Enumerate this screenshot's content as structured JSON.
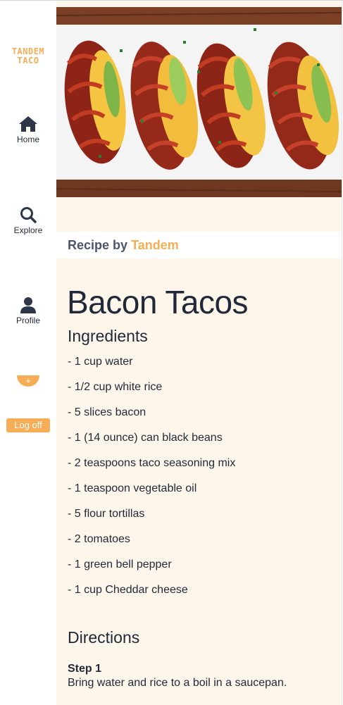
{
  "sidebar": {
    "logo": {
      "line1": "TANDEM",
      "line2": "TACO"
    },
    "home_label": "Home",
    "explore_label": "Explore",
    "profile_label": "Profile",
    "add_label": "+",
    "logoff_label": "Log off"
  },
  "recipe": {
    "byline_prefix": "Recipe by",
    "author": "Tandem",
    "title": "Bacon Tacos",
    "ingredients_heading": "Ingredients",
    "ingredients": [
      "- 1 cup water",
      "- 1/2 cup white rice",
      "- 5 slices bacon",
      "- 1 (14 ounce) can black beans",
      "- 2 teaspoons taco seasoning mix",
      "- 1 teaspoon vegetable oil",
      "- 5 flour tortillas",
      "- 2 tomatoes",
      "- 1 green bell pepper",
      "- 1 cup Cheddar cheese"
    ],
    "directions_heading": "Directions",
    "steps": [
      {
        "title": "Step 1",
        "text": "Bring water and rice to a boil in a saucepan."
      }
    ]
  },
  "colors": {
    "accent": "#f6ad55",
    "main_bg": "#fef5eb",
    "text": "#1f2937"
  },
  "icons": {
    "home": "home-icon",
    "explore": "search-icon",
    "profile": "user-icon"
  }
}
